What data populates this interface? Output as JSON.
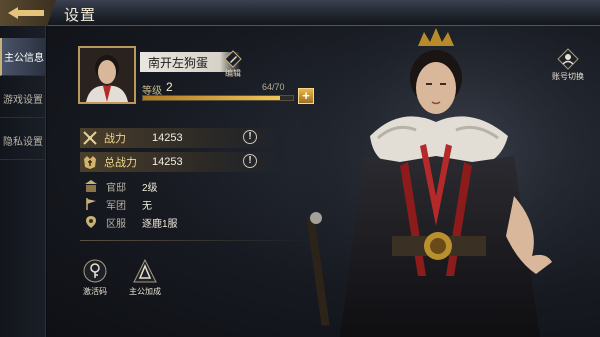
{
  "header": {
    "title": "设置"
  },
  "sidebar": {
    "tabs": [
      {
        "label": "主公信息",
        "active": true
      },
      {
        "label": "游戏设置",
        "active": false
      },
      {
        "label": "隐私设置",
        "active": false
      }
    ]
  },
  "profile": {
    "name": "南开左狗蛋",
    "edit_label": "编辑",
    "level_label": "等级",
    "level": "2",
    "exp_text": "64/70",
    "exp_fraction": 0.914,
    "plus_label": "+"
  },
  "stats": [
    {
      "label": "战力",
      "value": "14253",
      "icon": "crossed-swords-icon"
    },
    {
      "label": "总战力",
      "value": "14253",
      "icon": "crown-shield-icon"
    }
  ],
  "info_label": "!",
  "info": [
    {
      "label": "官邸",
      "value": "2级",
      "icon": "palace-icon"
    },
    {
      "label": "军团",
      "value": "无",
      "icon": "flag-icon"
    },
    {
      "label": "区服",
      "value": "逐鹿1服",
      "icon": "location-pin-icon"
    }
  ],
  "buttons": {
    "activation_code": "激活码",
    "lord_bonus": "主公加成",
    "switch_account": "账号切换"
  },
  "colors": {
    "accent_gold": "#f0c45a",
    "stat_gold": "#f0d690",
    "active_tab": "#4a5468"
  }
}
